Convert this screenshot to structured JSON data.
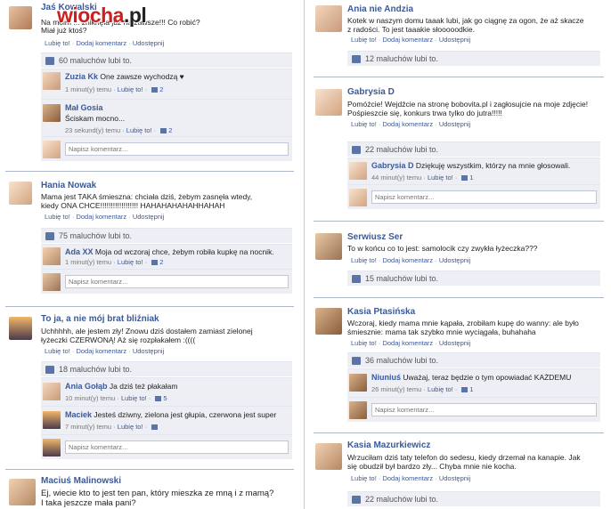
{
  "watermark": {
    "wiocha": "wiocha",
    "pl": ".pl"
  },
  "actions": {
    "like": "Lubię to!",
    "comment": "Dodaj komentarz",
    "share": "Udostępnij"
  },
  "comment_placeholder": "Napisz komentarz...",
  "left_posts": [
    {
      "name": "Jaś Kowalski",
      "text": [
        "Na moim ... zniknęła już na zawsze!!! Co robić?",
        "Miał już ktoś?"
      ],
      "likes": "60 maluchów lubi to.",
      "comments": [
        {
          "name": "Zuzia Kk",
          "text": "One zawsze wychodzą ♥",
          "time": "1 minut(y) temu",
          "like": "Lubię to!",
          "count": "2"
        },
        {
          "name": "Mał Gosia",
          "text": "Ściskam mocno...",
          "time": "23 sekund(y) temu",
          "like": "Lubię to!",
          "count": "2"
        }
      ]
    },
    {
      "name": "Hania Nowak",
      "text": [
        "Mama jest TAKA śmieszna: chciała dziś, żebym zasnęła wtedy,",
        "kiedy ONA CHCE!!!!!!!!!!!!!!!!!! HAHAHAHAHAHHAHAH"
      ],
      "likes": "75 maluchów lubi to.",
      "comments": [
        {
          "name": "Ada XX",
          "text": "Moja od wczoraj chce, żebym robiła kupkę na nocnik.",
          "time": "1 minut(y) temu",
          "like": "Lubię to!",
          "count": "2"
        }
      ]
    },
    {
      "name": "To ja, a nie mój brat bliźniak",
      "text": [
        "Uchhhhh, ale jestem zły! Znowu dziś dostałem zamiast zielonej",
        "łyżeczki CZERWONĄ! Aż się rozpłakałem :(((("
      ],
      "likes": "18 maluchów lubi to.",
      "comments": [
        {
          "name": "Ania Gołąb",
          "text": "Ja dziś też płakałam",
          "time": "10 minut(y) temu",
          "like": "Lubię to!",
          "count": "5"
        },
        {
          "name": "Maciek",
          "text": "Jesteś dziwny, zielona jest głupia, czerwona jest super",
          "time": "7 minut(y) temu",
          "like": "Lubię to!",
          "count": ""
        }
      ]
    },
    {
      "name": "Maciuś Malinowski",
      "text": [
        "Ej, wiecie kto to jest ten pan, który mieszka ze mną i z mamą?",
        "I taka jeszcze mała pani?"
      ]
    }
  ],
  "right_posts": [
    {
      "name": "Ania nie Andzia",
      "text": [
        "Kotek w naszym domu taaak lubi, jak go ciągnę za ogon, że aż skacze",
        "z radości. To jest taaakie słooooodkie."
      ],
      "likes": "12 maluchów lubi to."
    },
    {
      "name": "Gabrysia D",
      "text": [
        "Pomóżcie! Wejdźcie na stronę bobovita.pl i zagłosujcie na moje zdjęcie!",
        "Pośpieszcie się, konkurs trwa tylko do jutra!!!!!"
      ],
      "likes": "22 maluchów lubi to.",
      "comments": [
        {
          "name": "Gabrysia D",
          "text": "Dziękuję wszystkim, którzy na mnie głosowali.",
          "time": "44 minut(y) temu",
          "like": "Lubię to!",
          "count": "1"
        }
      ]
    },
    {
      "name": "Serwiusz Ser",
      "text": [
        "To w końcu co to jest: samolocik czy zwykła łyżeczka???"
      ],
      "likes": "15 maluchów lubi to."
    },
    {
      "name": "Kasia Ptasińska",
      "text": [
        "Wczoraj, kiedy mama mnie kąpała, zrobiłam kupę do wanny: ale było",
        "śmiesznie: mama tak szybko mnie wyciągała, buhahaha"
      ],
      "likes": "36 maluchów lubi to.",
      "comments": [
        {
          "name": "Niuniuś",
          "text": "Uważaj, teraz będzie o tym opowiadać KAŻDEMU",
          "time": "26 minut(y) temu",
          "like": "Lubię to!",
          "count": "1"
        }
      ]
    },
    {
      "name": "Kasia Mazurkiewicz",
      "text": [
        "Wrzuciłam dziś taty telefon do sedesu, kiedy drzemał na kanapie. Jak",
        "się obudził był bardzo zły... Chyba mnie nie kocha."
      ],
      "likes": "22 maluchów lubi to."
    }
  ]
}
